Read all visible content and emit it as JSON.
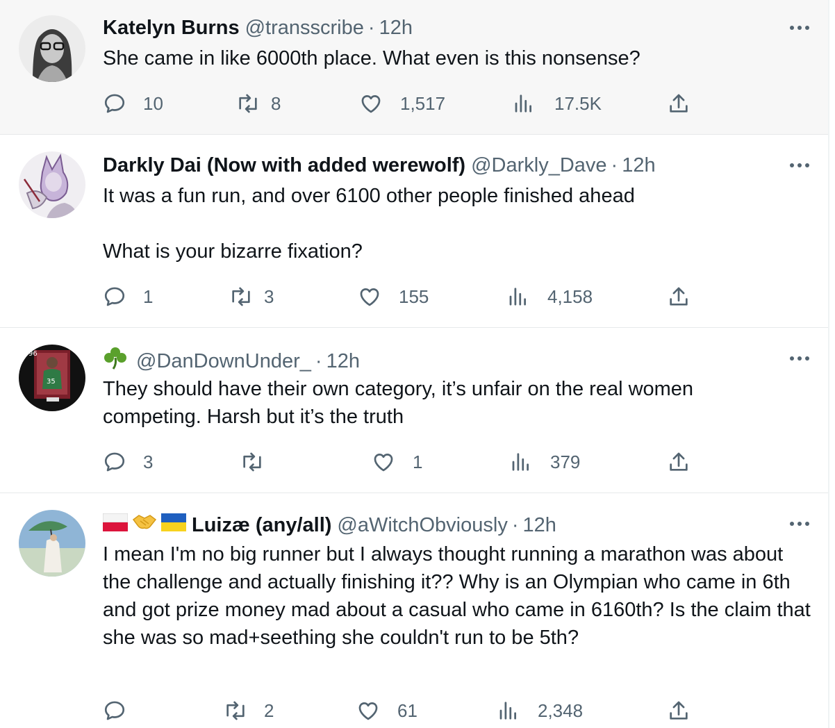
{
  "tweets": [
    {
      "name": "Katelyn Burns",
      "handle": "@transscribe",
      "time": "12h",
      "body": [
        "She came in like 6000th place. What even is this nonsense?"
      ],
      "replies": "10",
      "retweets": "8",
      "likes": "1,517",
      "views": "17.5K"
    },
    {
      "name": "Darkly Dai (Now with added werewolf)",
      "handle": "@Darkly_Dave",
      "time": "12h",
      "body": [
        "It was a fun run, and over 6100 other people finished ahead",
        "What is your bizarre fixation?"
      ],
      "replies": "1",
      "retweets": "3",
      "likes": "155",
      "views": "4,158"
    },
    {
      "name": "",
      "handle": "@DanDownUnder_",
      "time": "12h",
      "body": [
        "They should have their own category, it’s unfair on the real women competing. Harsh but it’s the truth"
      ],
      "replies": "3",
      "retweets": "",
      "likes": "1",
      "views": "379"
    },
    {
      "name": "Luizæ (any/all)",
      "handle": "@aWitchObviously",
      "time": "12h",
      "body": [
        "I mean I'm no big runner but I always thought running a marathon was about the challenge and actually finishing it?? Why is an Olympian who came in 6th and got prize money mad about a casual who came in 6160th? Is the claim that she was so mad+seething she couldn't run to be 5th?"
      ],
      "replies": "",
      "retweets": "2",
      "likes": "61",
      "views": "2,348"
    }
  ],
  "colors": {
    "text": "#0f1419",
    "secondary": "#536471",
    "divider": "#e7e9ea",
    "highlight_bg": "#f7f7f7"
  },
  "icons": [
    "reply-icon",
    "retweet-icon",
    "like-icon",
    "views-icon",
    "share-icon",
    "more-icon",
    "shamrock-icon",
    "poland-flag-icon",
    "handshake-icon",
    "ukraine-flag-icon"
  ]
}
